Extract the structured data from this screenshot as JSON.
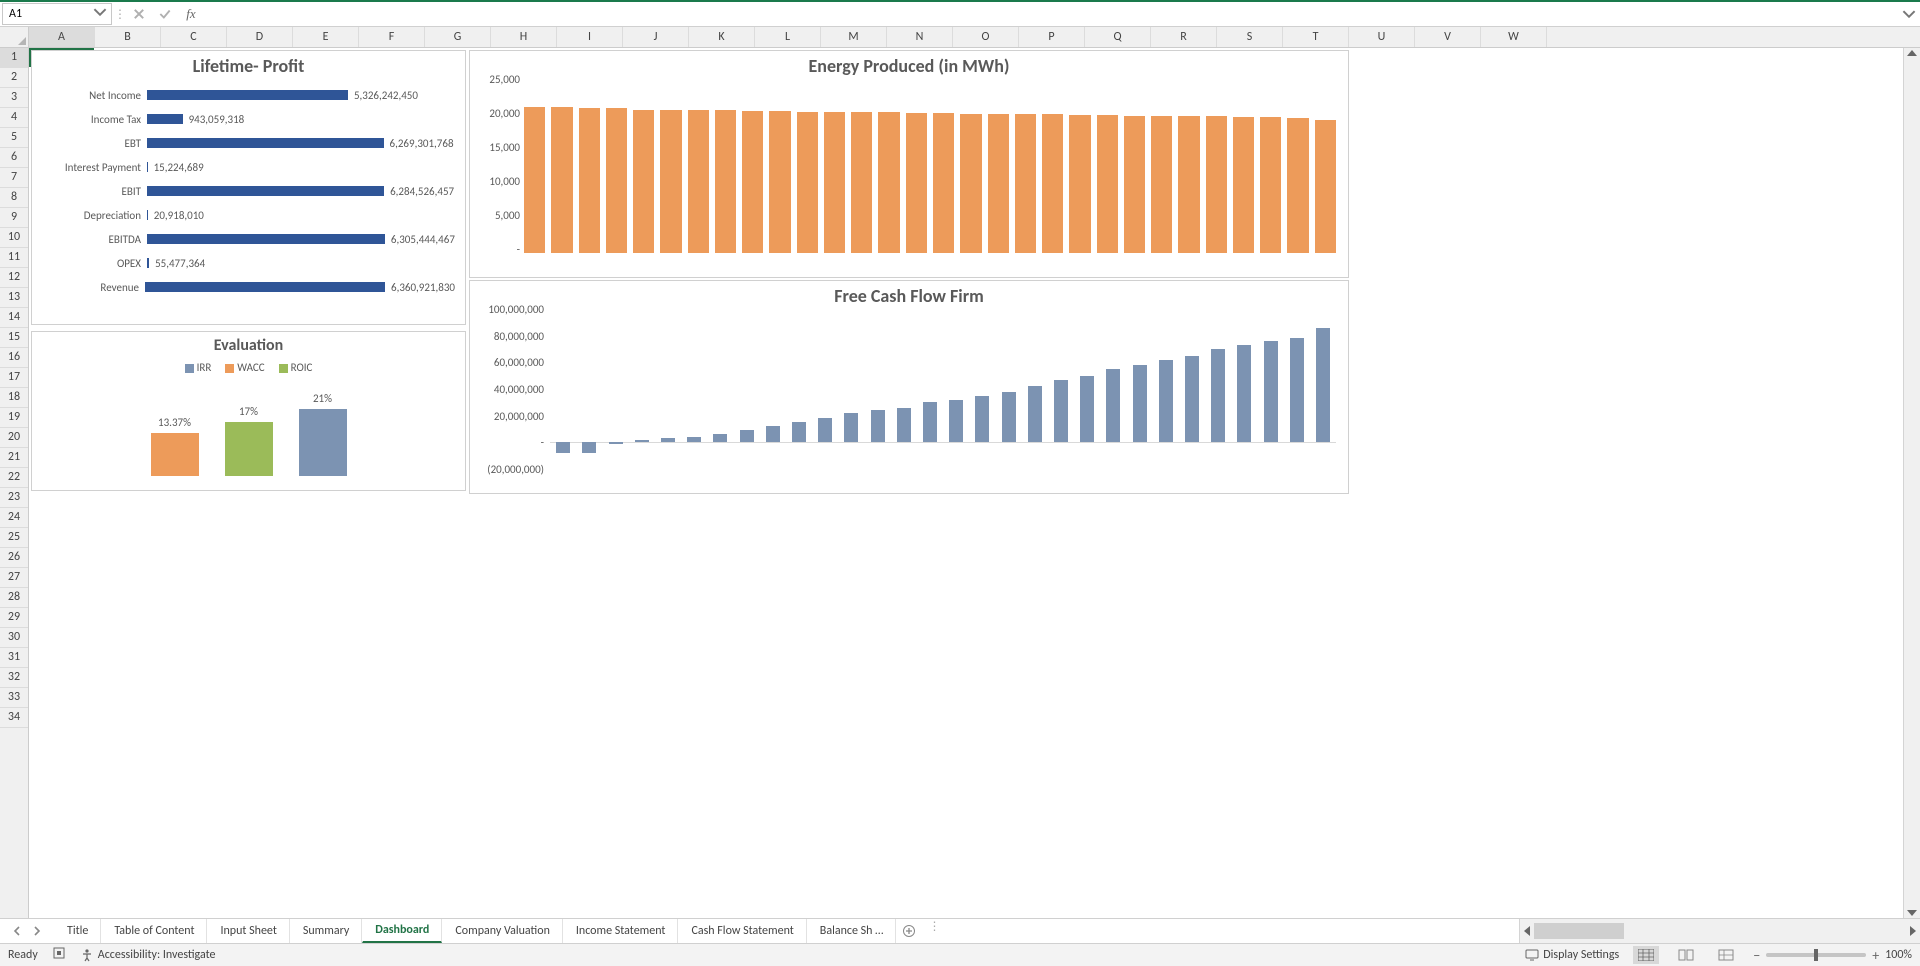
{
  "cell_ref": "A1",
  "formula": "",
  "columns": [
    "A",
    "B",
    "C",
    "D",
    "E",
    "F",
    "G",
    "H",
    "I",
    "J",
    "K",
    "L",
    "M",
    "N",
    "O",
    "P",
    "Q",
    "R",
    "S",
    "T",
    "U",
    "V",
    "W"
  ],
  "row_count": 34,
  "selected_col": "A",
  "selected_row": 1,
  "tabs": {
    "items": [
      {
        "label": "Title"
      },
      {
        "label": "Table of Content"
      },
      {
        "label": "Input Sheet"
      },
      {
        "label": "Summary"
      },
      {
        "label": "Dashboard"
      },
      {
        "label": "Company Valuation"
      },
      {
        "label": "Income Statement"
      },
      {
        "label": "Cash Flow Statement"
      },
      {
        "label": "Balance Sh …"
      }
    ],
    "active_index": 4
  },
  "status": {
    "ready": "Ready",
    "accessibility": "Accessibility: Investigate",
    "display_settings": "Display Settings",
    "zoom": "100%"
  },
  "chart_data": [
    {
      "type": "bar",
      "orientation": "horizontal",
      "title": "Lifetime- Profit",
      "categories": [
        "Net Income",
        "Income Tax",
        "EBT",
        "Interest Payment",
        "EBIT",
        "Depreciation",
        "EBITDA",
        "OPEX",
        "Revenue"
      ],
      "values": [
        5326242450,
        943059318,
        6269301768,
        15224689,
        6284526457,
        20918010,
        6305444467,
        55477364,
        6360921830
      ],
      "value_labels": [
        "5,326,242,450",
        "943,059,318",
        "6,269,301,768",
        "15,224,689",
        "6,284,526,457",
        "20,918,010",
        "6,305,444,467",
        "55,477,364",
        "6,360,921,830"
      ],
      "color": "#2f5597"
    },
    {
      "type": "bar",
      "title": "Evaluation",
      "series": [
        {
          "name": "IRR",
          "value": 0.21,
          "label": "21%",
          "color": "#7c93b2"
        },
        {
          "name": "WACC",
          "value": 0.1337,
          "label": "13.37%",
          "color": "#ed9b5a"
        },
        {
          "name": "ROIC",
          "value": 0.17,
          "label": "17%",
          "color": "#9bbb59"
        }
      ],
      "legend": [
        "IRR",
        "WACC",
        "ROIC"
      ]
    },
    {
      "type": "bar",
      "title": "Energy Produced (in MWh)",
      "ylabel": "",
      "ylim": [
        0,
        25000
      ],
      "yticks": [
        25000,
        20000,
        15000,
        10000,
        5000,
        0
      ],
      "ytick_labels": [
        "25,000",
        "20,000",
        "15,000",
        "10,000",
        "5,000",
        "-"
      ],
      "values": [
        21500,
        21500,
        21300,
        21300,
        21100,
        21100,
        21000,
        21000,
        20900,
        20900,
        20800,
        20800,
        20700,
        20700,
        20600,
        20600,
        20500,
        20500,
        20400,
        20400,
        20300,
        20300,
        20200,
        20200,
        20100,
        20100,
        20000,
        20000,
        19900,
        19500
      ],
      "color": "#ed9b5a"
    },
    {
      "type": "bar",
      "title": "Free Cash Flow Firm",
      "ylim": [
        -20000000,
        100000000
      ],
      "yticks": [
        100000000,
        80000000,
        60000000,
        40000000,
        20000000,
        0,
        -20000000
      ],
      "ytick_labels": [
        "100,000,000",
        "80,000,000",
        "60,000,000",
        "40,000,000",
        "20,000,000",
        "-",
        "(20,000,000)"
      ],
      "values": [
        -8000000,
        -8000000,
        -1000000,
        2000000,
        3000000,
        4000000,
        6000000,
        9000000,
        12000000,
        15000000,
        18000000,
        22000000,
        24000000,
        26000000,
        30000000,
        32000000,
        35000000,
        38000000,
        42000000,
        47000000,
        50000000,
        55000000,
        58000000,
        62000000,
        65000000,
        70000000,
        73000000,
        76000000,
        78000000,
        86000000
      ],
      "color": "#7c93b2"
    }
  ]
}
